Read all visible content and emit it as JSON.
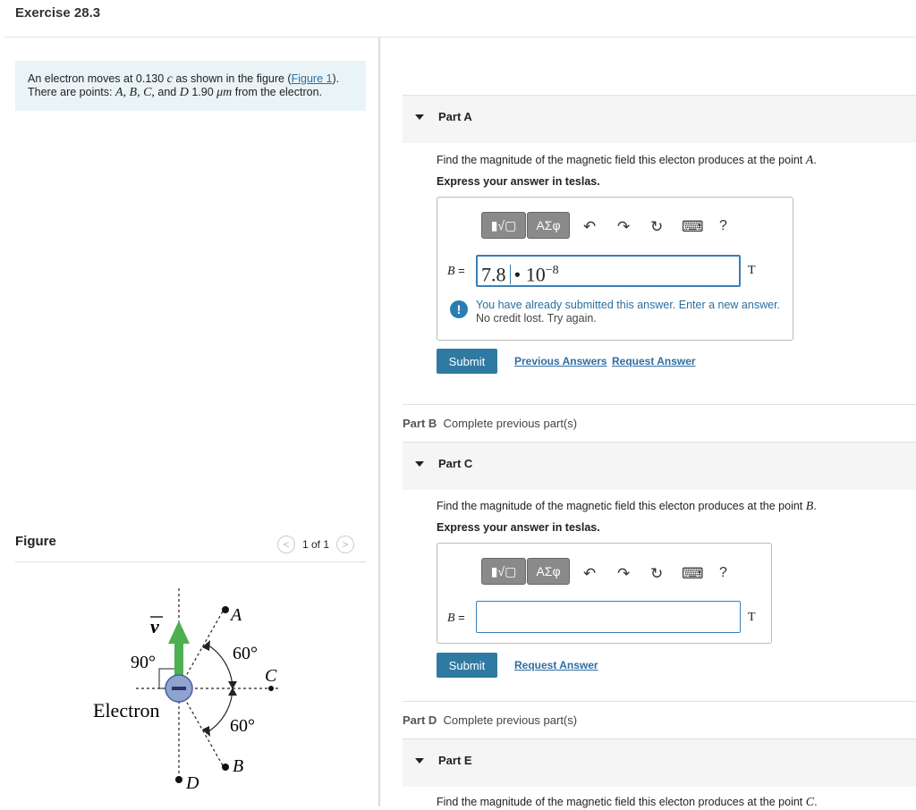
{
  "page_title": "Exercise 28.3",
  "problem": {
    "text_1": "An electron moves at 0.130",
    "c": "c",
    "text_2": " as shown in the figure (",
    "figure_link": "Figure 1",
    "text_3": ").",
    "line2_1": "There are points: ",
    "points": "A, B, C,",
    "and": " and ",
    "d": "D",
    "value": " 1.90 ",
    "unit": "μm",
    "line2_end": " from the electron."
  },
  "figure": {
    "label": "Figure",
    "pager": "1 of 1",
    "prev": "<",
    "next": ">",
    "labels": {
      "v": "v",
      "angle90": "90°",
      "electron": "Electron",
      "a": "A",
      "b": "B",
      "c": "C",
      "d": "D",
      "angle60_top": "60°",
      "angle60_bottom": "60°",
      "minus": "−"
    }
  },
  "toolbar": {
    "templates": "▮√▢",
    "greek": "ΑΣφ",
    "undo": "↶",
    "redo": "↷",
    "reset": "↻",
    "keyboard": "⌨",
    "help": "?"
  },
  "part_a": {
    "label": "Part A",
    "prompt": "Find the magnitude of the magnetic field this electon produces at the point ",
    "point": "A",
    "prompt_end": ".",
    "express": "Express your answer in teslas.",
    "var": "B",
    "eq": " =",
    "mantissa": "7.8",
    "dot": "•",
    "base": "10",
    "exponent": "−8",
    "unit": "T",
    "warning_1": "You have already submitted this answer. Enter a new answer.",
    "warning_2": "No credit lost. Try again.",
    "submit": "Submit",
    "previous_answers": "Previous Answers",
    "request_answer": "Request Answer"
  },
  "part_b": {
    "label": "Part B",
    "status": "Complete previous part(s)"
  },
  "part_c": {
    "label": "Part C",
    "prompt": "Find the magnitude of the magnetic field this electon produces at the point ",
    "point": "B",
    "prompt_end": ".",
    "express": "Express your answer in teslas.",
    "var": "B",
    "eq": " =",
    "value": "",
    "unit": "T",
    "submit": "Submit",
    "request_answer": "Request Answer"
  },
  "part_d": {
    "label": "Part D",
    "status": "Complete previous part(s)"
  },
  "part_e": {
    "label": "Part E",
    "prompt": "Find the magnitude of the magnetic field this electon produces at the point ",
    "point": "C",
    "prompt_end": "."
  }
}
